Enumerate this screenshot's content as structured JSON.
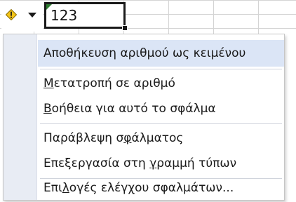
{
  "cell": {
    "value": "123"
  },
  "colors": {
    "highlight": "#dbe5f6",
    "gutter": "#e8ecf4",
    "warning": "#f5c518"
  },
  "smart_tag": {
    "icon": "warning-diamond-icon",
    "arrow_icon": "dropdown-arrow-icon"
  },
  "menu": {
    "items": [
      {
        "label": "Αποθήκευση αριθμού ως κειμένου",
        "pre": "",
        "key": "",
        "post": "Αποθήκευση αριθμού ως κειμένου",
        "highlighted": true
      },
      {
        "label": "Μετατροπή σε αριθμό",
        "pre": "",
        "key": "Μ",
        "post": "ετατροπή σε αριθμό",
        "highlighted": false
      },
      {
        "label": "Βοήθεια για αυτό το σφάλμα",
        "pre": "",
        "key": "Β",
        "post": "οήθεια για αυτό το σφάλμα",
        "highlighted": false
      },
      {
        "label": "Παράβλεψη σφάλματος",
        "pre": "Παράβλεψη σ",
        "key": "φ",
        "post": "άλματος",
        "highlighted": false
      },
      {
        "label": "Επεξεργασία στη γραμμή τύπων",
        "pre": "Επεξεργασία στη ",
        "key": "γ",
        "post": "ραμμή τύπων",
        "highlighted": false
      },
      {
        "label": "Επιλογές ελέγχου σφαλμάτων...",
        "pre": "Επι",
        "key": "λ",
        "post": "ογές ελέγχου σφαλμάτων...",
        "highlighted": false
      }
    ]
  }
}
